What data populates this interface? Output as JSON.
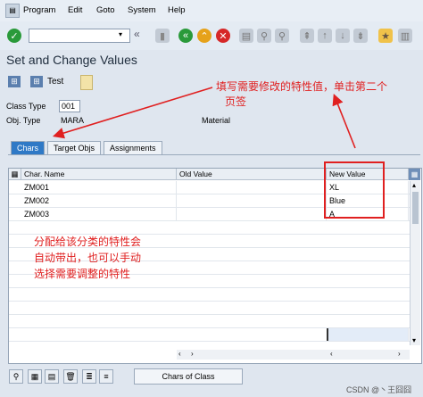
{
  "menu": {
    "program": "Program",
    "edit": "Edit",
    "goto": "Goto",
    "system": "System",
    "help": "Help"
  },
  "title": "Set and Change Values",
  "app_toolbar": {
    "test_label": "Test"
  },
  "fields": {
    "class_type_label": "Class Type",
    "class_type_value": "001",
    "obj_type_label": "Obj. Type",
    "obj_type_value": "MARA",
    "material_label": "Material"
  },
  "tabs": [
    "Chars",
    "Target Objs",
    "Assignments"
  ],
  "grid": {
    "headers": {
      "char_name": "Char. Name",
      "old_value": "Old Value",
      "new_value": "New Value"
    },
    "rows": [
      {
        "char": "ZM001",
        "old": "",
        "new": "XL"
      },
      {
        "char": "ZM002",
        "old": "",
        "new": "Blue"
      },
      {
        "char": "ZM003",
        "old": "",
        "new": "A"
      }
    ]
  },
  "annotations": {
    "top": "填写需要修改的特性值，单击第二个",
    "top2": "页签",
    "left1": "分配给该分类的特性会",
    "left2": "自动带出，也可以手动",
    "left3": "选择需要调整的特性"
  },
  "bottom": {
    "chars_of_class": "Chars of Class"
  },
  "watermark": "CSDN @丶王囧囧",
  "colors": {
    "annotation": "#e02020",
    "tab_active": "#2f79c6"
  }
}
